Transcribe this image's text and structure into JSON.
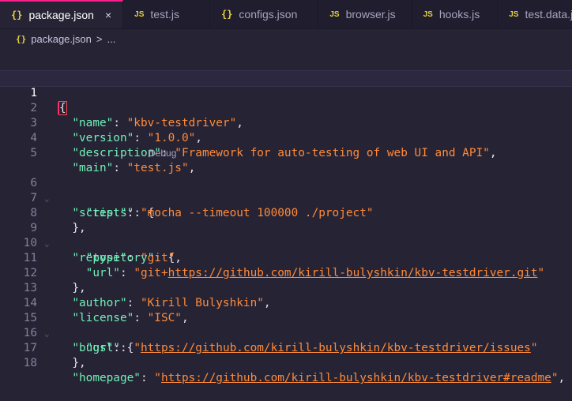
{
  "tabs": [
    {
      "icon": "{}",
      "kind": "json",
      "label": "package.json",
      "active": true,
      "close": "×"
    },
    {
      "icon": "JS",
      "kind": "js",
      "label": "test.js"
    },
    {
      "icon": "{}",
      "kind": "json",
      "label": "configs.json"
    },
    {
      "icon": "JS",
      "kind": "js",
      "label": "browser.js"
    },
    {
      "icon": "JS",
      "kind": "js",
      "label": "hooks.js"
    },
    {
      "icon": "JS",
      "kind": "js",
      "label": "test.data.js"
    }
  ],
  "breadcrumb": {
    "icon": "{}",
    "file": "package.json",
    "sep": ">",
    "more": "..."
  },
  "codelens": {
    "label": "Debug",
    "icon": "▷"
  },
  "lines": {
    "n1": "1",
    "n2": "2",
    "n3": "3",
    "n4": "4",
    "n5": "5",
    "n6": "6",
    "n7": "7",
    "n8": "8",
    "n9": "9",
    "n10": "10",
    "n11": "11",
    "n12": "12",
    "n13": "13",
    "n14": "14",
    "n15": "15",
    "n16": "16",
    "n17": "17",
    "n18": "18"
  },
  "code": {
    "l1_open": "{",
    "l2_key": "\"name\"",
    "l2_val": "\"kbv-testdriver\"",
    "l3_key": "\"version\"",
    "l3_val": "\"1.0.0\"",
    "l4_key": "\"description\"",
    "l4_val": "\"Framework for auto-testing of web UI and API\"",
    "l5_key": "\"main\"",
    "l5_val": "\"test.js\"",
    "l6_key": "\"scripts\"",
    "l7_key": "\"test\"",
    "l7_val": "\"mocha --timeout 100000 ./project\"",
    "l9_key": "\"repository\"",
    "l10_key": "\"type\"",
    "l10_val": "\"git\"",
    "l11_key": "\"url\"",
    "l11_pre": "\"git+",
    "l11_url": "https://github.com/kirill-bulyshkin/kbv-testdriver.git",
    "l11_post": "\"",
    "l13_key": "\"author\"",
    "l13_val": "\"Kirill Bulyshkin\"",
    "l14_key": "\"license\"",
    "l14_val": "\"ISC\"",
    "l15_key": "\"bugs\"",
    "l16_key": "\"url\"",
    "l16_pre": "\"",
    "l16_url": "https://github.com/kirill-bulyshkin/kbv-testdriver/issues",
    "l16_post": "\"",
    "l18_key": "\"homepage\"",
    "l18_pre": "\"",
    "l18_url": "https://github.com/kirill-bulyshkin/kbv-testdriver#readme",
    "l18_post": "\""
  },
  "colors": {
    "accent": "#f61f8c",
    "key": "#72f1b8",
    "string": "#ff8b39",
    "background": "#262335"
  }
}
